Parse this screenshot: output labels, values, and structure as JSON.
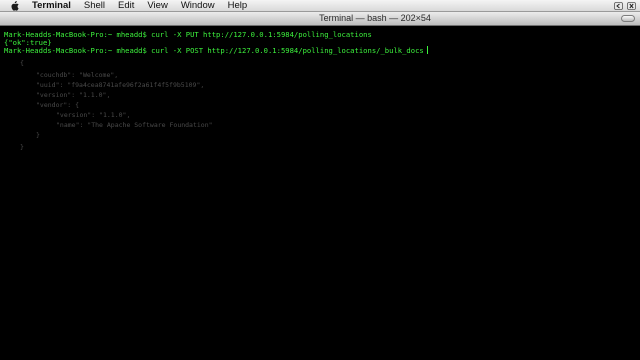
{
  "menubar": {
    "apple_icon": "apple-logo-icon",
    "app_name": "Terminal",
    "items": [
      "Shell",
      "Edit",
      "View",
      "Window",
      "Help"
    ],
    "status_icons": [
      "back-icon",
      "close-icon"
    ]
  },
  "window": {
    "title": "Terminal — bash — 202×54"
  },
  "terminal": {
    "lines": [
      "Mark-Headds-MacBook-Pro:~ mheadd$ curl -X PUT http://127.0.0.1:5984/polling_locations",
      "{\"ok\":true}",
      "Mark-Headds-MacBook-Pro:~ mheadd$ curl -X POST http://127.0.0.1:5984/polling_locations/_bulk_docs"
    ],
    "response_json": [
      "{",
      "\"couchdb\": \"Welcome\",",
      "\"uuid\": \"f9a4cea8741afe96f2a61f4f5f9b5109\",",
      "\"version\": \"1.1.0\",",
      "\"vendor\": {",
      "\"version\": \"1.1.0\",",
      "\"name\": \"The Apache Software Foundation\"",
      "}",
      "}"
    ]
  }
}
